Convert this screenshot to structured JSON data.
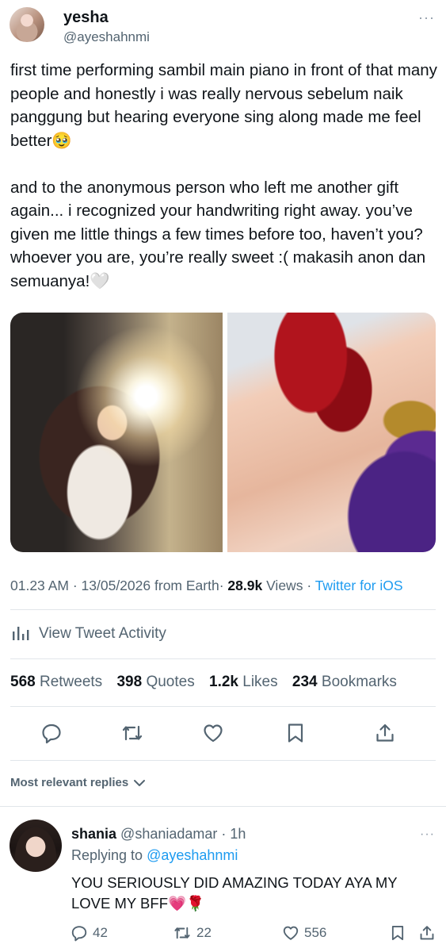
{
  "tweet": {
    "author_name": "yesha",
    "author_handle": "@ayeshahnmi",
    "more": "···",
    "text": "first time performing sambil main piano in front of that many people and honestly i was really nervous sebelum naik panggung but hearing everyone sing along made me feel better🥹\n\nand to the anonymous person who left me another gift again... i recognized your handwriting right away. you’ve given me little things a few times before too, haven’t you? whoever you are, you’re really sweet :( makasih anon dan semuanya!🤍",
    "time": "01.23 AM",
    "date": "13/05/2026",
    "location": "from Earth",
    "views_count": "28.9k",
    "views_label": "Views",
    "client": "Twitter for iOS",
    "sep": "·"
  },
  "activity_label": "View Tweet Activity",
  "stats": {
    "retweets_count": "568",
    "retweets_label": "Retweets",
    "quotes_count": "398",
    "quotes_label": "Quotes",
    "likes_count": "1.2k",
    "likes_label": "Likes",
    "bookmarks_count": "234",
    "bookmarks_label": "Bookmarks"
  },
  "sort_label": "Most relevant replies",
  "reply": {
    "author_name": "shania",
    "author_handle": "@shaniadamar",
    "time": "· 1h",
    "more": "···",
    "replying_prefix": "Replying to",
    "replying_handle": "@ayeshahnmi",
    "text": "YOU SERIOUSLY DID AMAZING TODAY AYA MY LOVE MY BFF💗🌹",
    "replies": "42",
    "retweets": "22",
    "likes": "556"
  },
  "colors": {
    "accent": "#1d9bf0",
    "text": "#0f1419",
    "muted": "#536471"
  }
}
